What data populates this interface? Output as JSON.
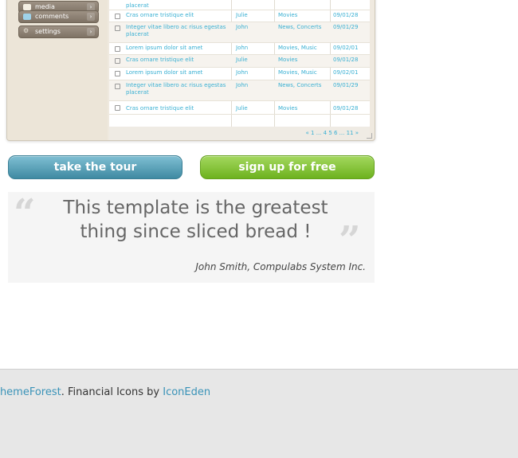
{
  "sidebar": {
    "items": [
      {
        "label": "media",
        "icon": "media-icon"
      },
      {
        "label": "comments",
        "icon": "comments-icon"
      },
      {
        "label": "settings",
        "icon": "settings-icon"
      }
    ]
  },
  "table": {
    "rows": [
      {
        "title": "placerat",
        "author": "",
        "tags": "",
        "date": ""
      },
      {
        "title": "Cras ornare tristique elit",
        "author": "Julie",
        "tags": "Movies",
        "date": "09/01/28"
      },
      {
        "title": "Integer vitae libero ac risus egestas placerat",
        "author": "John",
        "tags": "News, Concerts",
        "date": "09/01/29"
      },
      {
        "title": "Lorem ipsum dolor sit amet",
        "author": "John",
        "tags": "Movies, Music",
        "date": "09/02/01"
      },
      {
        "title": "Cras ornare tristique elit",
        "author": "Julie",
        "tags": "Movies",
        "date": "09/01/28"
      },
      {
        "title": "Lorem ipsum dolor sit amet",
        "author": "John",
        "tags": "Movies, Music",
        "date": "09/02/01"
      },
      {
        "title": "Integer vitae libero ac risus egestas placerat",
        "author": "John",
        "tags": "News, Concerts",
        "date": "09/01/29"
      },
      {
        "title": "Cras ornare tristique elit",
        "author": "Julie",
        "tags": "Movies",
        "date": "09/01/28"
      }
    ],
    "pager": "« 1 ... 4 5 6 ... 11 »"
  },
  "cta": {
    "tour_label": "take the tour",
    "signup_label": "sign up for free"
  },
  "testimonial": {
    "quote": "This template is the greatest thing since sliced bread !",
    "author": "John Smith, Compulabs System Inc."
  },
  "footer": {
    "link1": "ThemeForest",
    "text1": ". Financial Icons by ",
    "link2": "IconEden"
  },
  "colors": {
    "tour": "#4f9ab2",
    "signup": "#7fc033",
    "link": "#3ab0d3"
  }
}
